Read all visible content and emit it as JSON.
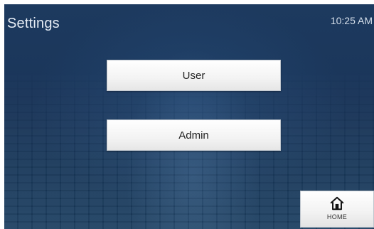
{
  "header": {
    "title": "Settings",
    "time": "10:25 AM"
  },
  "menu": {
    "items": [
      {
        "label": "User"
      },
      {
        "label": "Admin"
      }
    ]
  },
  "footer": {
    "home_label": "HOME",
    "home_icon": "home-icon"
  },
  "colors": {
    "background": "#1a3559",
    "button_face": "#f3f3f3",
    "title_text": "#e6edf5"
  }
}
